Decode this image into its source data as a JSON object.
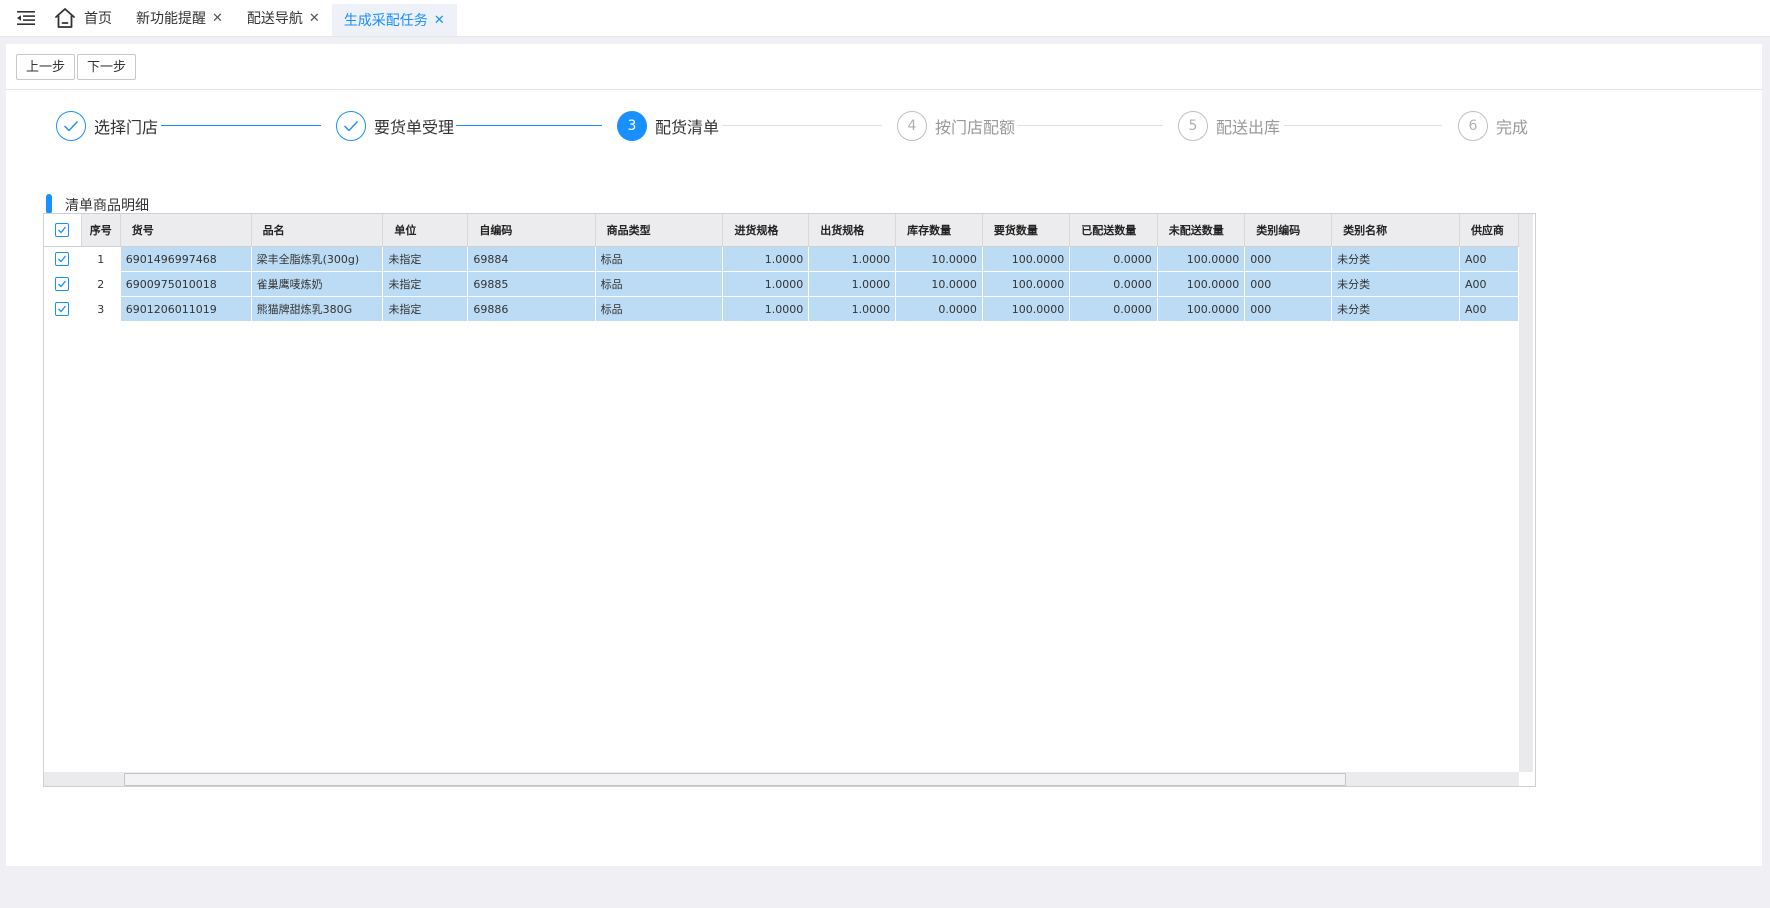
{
  "tabs": [
    {
      "label": "首页",
      "closable": false
    },
    {
      "label": "新功能提醒",
      "closable": true
    },
    {
      "label": "配送导航",
      "closable": true
    },
    {
      "label": "生成采配任务",
      "closable": true,
      "active": true
    }
  ],
  "close_glyph": "✕",
  "toolbar": {
    "prev_label": "上一步",
    "next_label": "下一步"
  },
  "steps": [
    {
      "number": "1",
      "label": "选择门店",
      "status": "done"
    },
    {
      "number": "2",
      "label": "要货单受理",
      "status": "done"
    },
    {
      "number": "3",
      "label": "配货清单",
      "status": "current"
    },
    {
      "number": "4",
      "label": "按门店配额",
      "status": "todo"
    },
    {
      "number": "5",
      "label": "配送出库",
      "status": "todo"
    },
    {
      "number": "6",
      "label": "完成",
      "status": "todo"
    }
  ],
  "section": {
    "title": "清单商品明细"
  },
  "table": {
    "columns": [
      "序号",
      "货号",
      "品名",
      "单位",
      "自编码",
      "商品类型",
      "进货规格",
      "出货规格",
      "库存数量",
      "要货数量",
      "已配送数量",
      "未配送数量",
      "类别编码",
      "类别名称",
      "供应商"
    ],
    "rows": [
      {
        "seq": "1",
        "sku": "6901496997468",
        "name": "梁丰全脂炼乳(300g)",
        "unit": "未指定",
        "code": "69884",
        "type": "标品",
        "in_spec": "1.0000",
        "out_spec": "1.0000",
        "stock": "10.0000",
        "req": "100.0000",
        "delivered": "0.0000",
        "undelivered": "100.0000",
        "cat_code": "000",
        "cat_name": "未分类",
        "supplier": "A00"
      },
      {
        "seq": "2",
        "sku": "6900975010018",
        "name": "雀巢鹰唛炼奶",
        "unit": "未指定",
        "code": "69885",
        "type": "标品",
        "in_spec": "1.0000",
        "out_spec": "1.0000",
        "stock": "10.0000",
        "req": "100.0000",
        "delivered": "0.0000",
        "undelivered": "100.0000",
        "cat_code": "000",
        "cat_name": "未分类",
        "supplier": "A00"
      },
      {
        "seq": "3",
        "sku": "6901206011019",
        "name": "熊猫牌甜炼乳380G",
        "unit": "未指定",
        "code": "69886",
        "type": "标品",
        "in_spec": "1.0000",
        "out_spec": "1.0000",
        "stock": "0.0000",
        "req": "100.0000",
        "delivered": "0.0000",
        "undelivered": "100.0000",
        "cat_code": "000",
        "cat_name": "未分类",
        "supplier": "A00"
      }
    ]
  },
  "colors": {
    "accent": "#1890ff",
    "row_selected": "#bcdcf5"
  }
}
